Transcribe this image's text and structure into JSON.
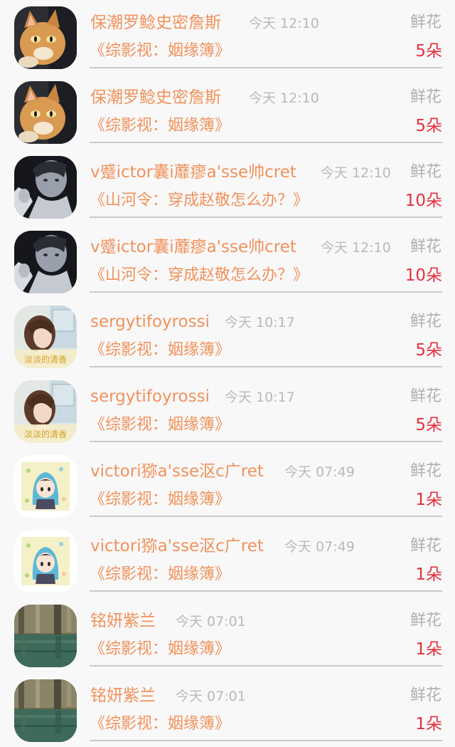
{
  "colors": {
    "name": "#f0925a",
    "book": "#f0925a",
    "count": "#e3303e",
    "time": "#b9b9b9",
    "gift": "#b0b0b0",
    "background": "#f9f8f9",
    "divider": "#c9c9c9"
  },
  "rows": [
    {
      "avatar": "cat-avatar",
      "name": "保潮罗鲶史密詹斯",
      "time": "今天 12:10",
      "gift": "鲜花",
      "book": "《综影视：姻缘簿》",
      "count": "5朵"
    },
    {
      "avatar": "cat-avatar",
      "name": "保潮罗鲶史密詹斯",
      "time": "今天 12:10",
      "gift": "鲜花",
      "book": "《综影视：姻缘簿》",
      "count": "5朵"
    },
    {
      "avatar": "portrait-bw-avatar",
      "name": "v蹙ictor囊i蘼瘳a'sse帅cret",
      "time": "今天 12:10",
      "gift": "鲜花",
      "book": "《山河令：穿成赵敬怎么办？》",
      "count": "10朵"
    },
    {
      "avatar": "portrait-bw-avatar",
      "name": "v蹙ictor囊i蘼瘳a'sse帅cret",
      "time": "今天 12:10",
      "gift": "鲜花",
      "book": "《山河令：穿成赵敬怎么办？》",
      "count": "10朵"
    },
    {
      "avatar": "girl-avatar",
      "avatar_text": "淡淡的清香",
      "name": "sergytifoyrossi",
      "time": "今天 10:17",
      "gift": "鲜花",
      "book": "《综影视：姻缘簿》",
      "count": "5朵"
    },
    {
      "avatar": "girl-avatar",
      "avatar_text": "淡淡的清香",
      "name": "sergytifoyrossi",
      "time": "今天 10:17",
      "gift": "鲜花",
      "book": "《综影视：姻缘簿》",
      "count": "5朵"
    },
    {
      "avatar": "cartoon-avatar",
      "name": "victori猕a'sse沤c广ret",
      "time": "今天 07:49",
      "gift": "鲜花",
      "book": "《综影视：姻缘簿》",
      "count": "1朵"
    },
    {
      "avatar": "cartoon-avatar",
      "name": "victori猕a'sse沤c广ret",
      "time": "今天 07:49",
      "gift": "鲜花",
      "book": "《综影视：姻缘簿》",
      "count": "1朵"
    },
    {
      "avatar": "lake-avatar",
      "name": "铭妍紫兰",
      "time": "今天 07:01",
      "gift": "鲜花",
      "book": "《综影视：姻缘簿》",
      "count": "1朵"
    },
    {
      "avatar": "lake-avatar",
      "name": "铭妍紫兰",
      "time": "今天 07:01",
      "gift": "鲜花",
      "book": "《综影视：姻缘簿》",
      "count": "1朵"
    }
  ]
}
